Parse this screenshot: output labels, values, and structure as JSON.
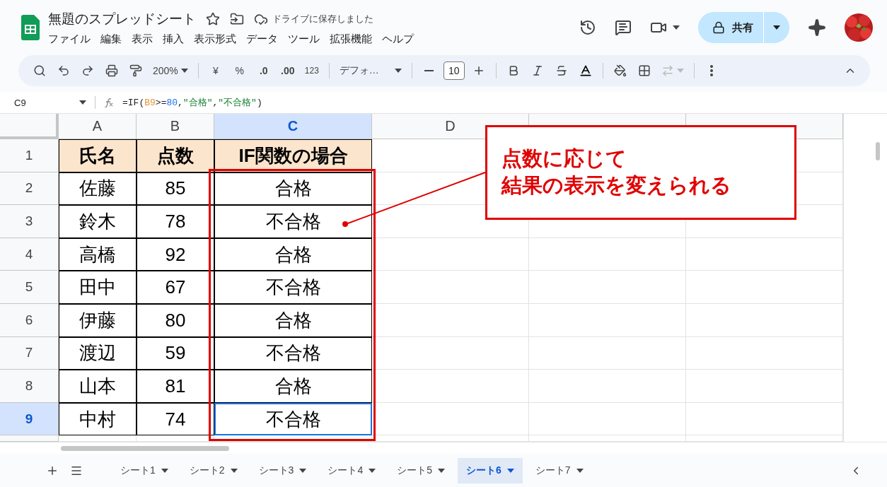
{
  "header": {
    "title": "無題のスプレッドシート",
    "saved_status": "ドライブに保存しました",
    "menu": [
      "ファイル",
      "編集",
      "表示",
      "挿入",
      "表示形式",
      "データ",
      "ツール",
      "拡張機能",
      "ヘルプ"
    ],
    "share_label": "共有"
  },
  "toolbar": {
    "zoom": "200%",
    "currency": "¥",
    "percent": "%",
    "decimal_decrease": ".0",
    "decimal_increase": ".00",
    "number_format": "123",
    "font": "デフォ…",
    "font_size": "10"
  },
  "formula_bar": {
    "cell_ref": "C9",
    "formula": [
      {
        "text": "=IF(",
        "kind": "plain"
      },
      {
        "text": "B9",
        "kind": "ref"
      },
      {
        "text": ">=",
        "kind": "plain"
      },
      {
        "text": "80",
        "kind": "number"
      },
      {
        "text": ",",
        "kind": "plain"
      },
      {
        "text": "\"合格\"",
        "kind": "string"
      },
      {
        "text": ",",
        "kind": "plain"
      },
      {
        "text": "\"不合格\"",
        "kind": "string"
      },
      {
        "text": ")",
        "kind": "plain"
      }
    ]
  },
  "sheet": {
    "columns": [
      {
        "label": "A",
        "selected": false
      },
      {
        "label": "B",
        "selected": false
      },
      {
        "label": "C",
        "selected": true
      },
      {
        "label": "D",
        "selected": false
      }
    ],
    "rows": [
      {
        "label": "1",
        "kind": "header",
        "selected": false,
        "cells": [
          {
            "text": "氏名",
            "selected": false
          },
          {
            "text": "点数",
            "selected": false
          },
          {
            "text": "IF関数の場合",
            "selected": false
          }
        ]
      },
      {
        "label": "2",
        "kind": "data",
        "selected": false,
        "cells": [
          {
            "text": "佐藤",
            "selected": false
          },
          {
            "text": "85",
            "selected": false
          },
          {
            "text": "合格",
            "selected": false
          }
        ]
      },
      {
        "label": "3",
        "kind": "data",
        "selected": false,
        "cells": [
          {
            "text": "鈴木",
            "selected": false
          },
          {
            "text": "78",
            "selected": false
          },
          {
            "text": "不合格",
            "selected": false
          }
        ]
      },
      {
        "label": "4",
        "kind": "data",
        "selected": false,
        "cells": [
          {
            "text": "高橋",
            "selected": false
          },
          {
            "text": "92",
            "selected": false
          },
          {
            "text": "合格",
            "selected": false
          }
        ]
      },
      {
        "label": "5",
        "kind": "data",
        "selected": false,
        "cells": [
          {
            "text": "田中",
            "selected": false
          },
          {
            "text": "67",
            "selected": false
          },
          {
            "text": "不合格",
            "selected": false
          }
        ]
      },
      {
        "label": "6",
        "kind": "data",
        "selected": false,
        "cells": [
          {
            "text": "伊藤",
            "selected": false
          },
          {
            "text": "80",
            "selected": false
          },
          {
            "text": "合格",
            "selected": false
          }
        ]
      },
      {
        "label": "7",
        "kind": "data",
        "selected": false,
        "cells": [
          {
            "text": "渡辺",
            "selected": false
          },
          {
            "text": "59",
            "selected": false
          },
          {
            "text": "不合格",
            "selected": false
          }
        ]
      },
      {
        "label": "8",
        "kind": "data",
        "selected": false,
        "cells": [
          {
            "text": "山本",
            "selected": false
          },
          {
            "text": "81",
            "selected": false
          },
          {
            "text": "合格",
            "selected": false
          }
        ]
      },
      {
        "label": "9",
        "kind": "data",
        "selected": true,
        "cells": [
          {
            "text": "中村",
            "selected": false
          },
          {
            "text": "74",
            "selected": false
          },
          {
            "text": "不合格",
            "selected": true
          }
        ]
      }
    ],
    "callout": {
      "lines": [
        "点数に応じて",
        "結果の表示を変えられる"
      ]
    }
  },
  "sheet_tabs": [
    {
      "label": "シート1",
      "selected": false
    },
    {
      "label": "シート2",
      "selected": false
    },
    {
      "label": "シート3",
      "selected": false
    },
    {
      "label": "シート4",
      "selected": false
    },
    {
      "label": "シート5",
      "selected": false
    },
    {
      "label": "シート6",
      "selected": true
    },
    {
      "label": "シート7",
      "selected": false
    }
  ]
}
